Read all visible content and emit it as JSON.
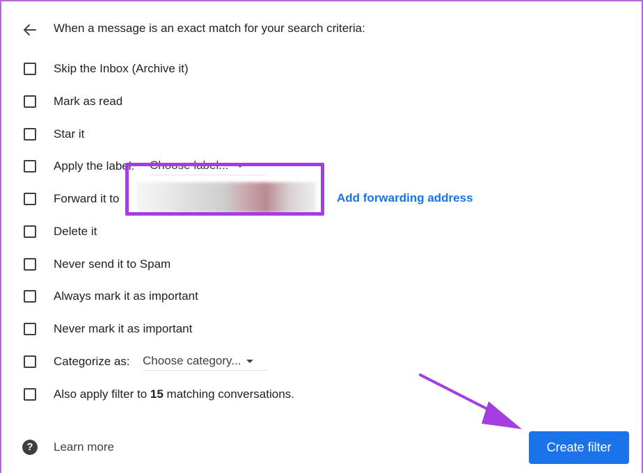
{
  "header": {
    "text": "When a message is an exact match for your search criteria:"
  },
  "options": {
    "skip_inbox": "Skip the Inbox (Archive it)",
    "mark_read": "Mark as read",
    "star": "Star it",
    "apply_label": "Apply the label:",
    "apply_label_select": "Choose label...",
    "forward": "Forward it to",
    "add_forwarding": "Add forwarding address",
    "delete": "Delete it",
    "never_spam": "Never send it to Spam",
    "always_important": "Always mark it as important",
    "never_important": "Never mark it as important",
    "categorize": "Categorize as:",
    "categorize_select": "Choose category...",
    "also_apply_prefix": "Also apply filter to ",
    "also_apply_count": "15",
    "also_apply_suffix": " matching conversations."
  },
  "footer": {
    "help_glyph": "?",
    "learn_more": "Learn more",
    "create_filter": "Create filter"
  },
  "colors": {
    "accent": "#1a73e8",
    "highlight": "#a33fe0"
  }
}
